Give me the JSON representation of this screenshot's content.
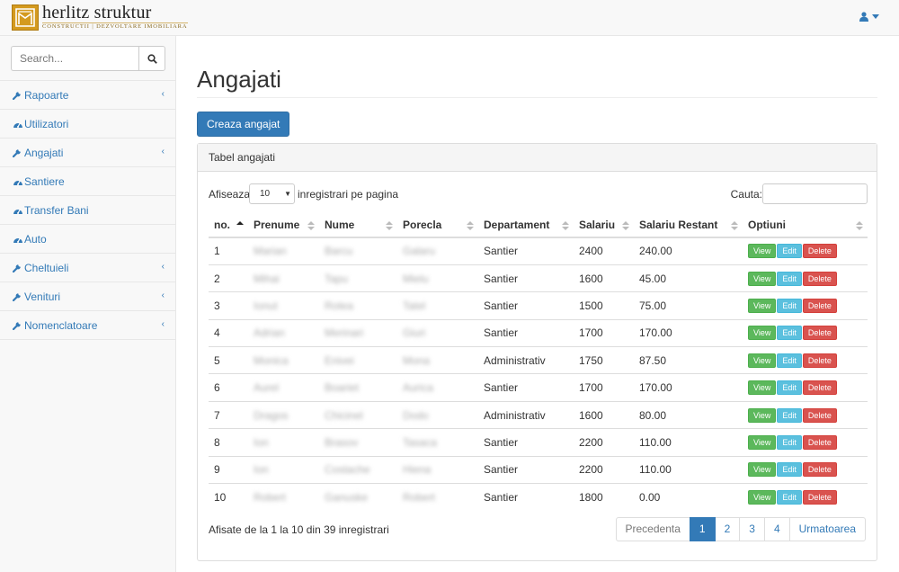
{
  "brand": {
    "name": "herlitz struktur",
    "tagline": "CONSTRUCTII | DEZVOLTARE IMOBILIARA"
  },
  "user_menu": {
    "icon": "user-icon"
  },
  "sidebar": {
    "search_placeholder": "Search...",
    "items": [
      {
        "label": "Rapoarte",
        "icon": "wrench-icon",
        "has_submenu": true
      },
      {
        "label": "Utilizatori",
        "icon": "dashboard-icon",
        "has_submenu": false
      },
      {
        "label": "Angajati",
        "icon": "wrench-icon",
        "has_submenu": true
      },
      {
        "label": "Santiere",
        "icon": "dashboard-icon",
        "has_submenu": false
      },
      {
        "label": "Transfer Bani",
        "icon": "dashboard-icon",
        "has_submenu": false
      },
      {
        "label": "Auto",
        "icon": "dashboard-icon",
        "has_submenu": false
      },
      {
        "label": "Cheltuieli",
        "icon": "wrench-icon",
        "has_submenu": true
      },
      {
        "label": "Venituri",
        "icon": "wrench-icon",
        "has_submenu": true
      },
      {
        "label": "Nomenclatoare",
        "icon": "wrench-icon",
        "has_submenu": true
      }
    ]
  },
  "main": {
    "title": "Angajati",
    "create_button": "Creaza angajat",
    "panel_title": "Tabel angajati",
    "length_label": "Afiseaza",
    "length_value": "10",
    "length_suffix": "inregistrari pe pagina",
    "search_label": "Cauta:",
    "columns": [
      "no.",
      "Prenume",
      "Nume",
      "Porecla",
      "Departament",
      "Salariu",
      "Salariu Restant",
      "Optiuni"
    ],
    "rows": [
      {
        "no": "1",
        "prenume": "Marian",
        "nume": "Barcu",
        "porecla": "Galaru",
        "departament": "Santier",
        "salariu": "2400",
        "restant": "240.00"
      },
      {
        "no": "2",
        "prenume": "Mihai",
        "nume": "Tapu",
        "porecla": "Mielu",
        "departament": "Santier",
        "salariu": "1600",
        "restant": "45.00"
      },
      {
        "no": "3",
        "prenume": "Ionut",
        "nume": "Rotea",
        "porecla": "Tatel",
        "departament": "Santier",
        "salariu": "1500",
        "restant": "75.00"
      },
      {
        "no": "4",
        "prenume": "Adrian",
        "nume": "Merinari",
        "porecla": "Giuri",
        "departament": "Santier",
        "salariu": "1700",
        "restant": "170.00"
      },
      {
        "no": "5",
        "prenume": "Monica",
        "nume": "Enivei",
        "porecla": "Mona",
        "departament": "Administrativ",
        "salariu": "1750",
        "restant": "87.50"
      },
      {
        "no": "6",
        "prenume": "Aurel",
        "nume": "Boariet",
        "porecla": "Aurica",
        "departament": "Santier",
        "salariu": "1700",
        "restant": "170.00"
      },
      {
        "no": "7",
        "prenume": "Dragos",
        "nume": "Chicinel",
        "porecla": "Dodo",
        "departament": "Administrativ",
        "salariu": "1600",
        "restant": "80.00"
      },
      {
        "no": "8",
        "prenume": "Ion",
        "nume": "Brasov",
        "porecla": "Tasaca",
        "departament": "Santier",
        "salariu": "2200",
        "restant": "110.00"
      },
      {
        "no": "9",
        "prenume": "Ion",
        "nume": "Costache",
        "porecla": "Hiena",
        "departament": "Santier",
        "salariu": "2200",
        "restant": "110.00"
      },
      {
        "no": "10",
        "prenume": "Robert",
        "nume": "Ganuske",
        "porecla": "Robert",
        "departament": "Santier",
        "salariu": "1800",
        "restant": "0.00"
      }
    ],
    "actions": {
      "view": "View",
      "edit": "Edit",
      "delete": "Delete"
    },
    "info": "Afisate de la 1 la 10 din 39 inregistrari",
    "pagination": {
      "prev": "Precedenta",
      "pages": [
        "1",
        "2",
        "3",
        "4"
      ],
      "active": "1",
      "next": "Urmatoarea"
    }
  },
  "colors": {
    "primary": "#337ab7",
    "success": "#5cb85c",
    "info": "#5bc0de",
    "danger": "#d9534f"
  }
}
